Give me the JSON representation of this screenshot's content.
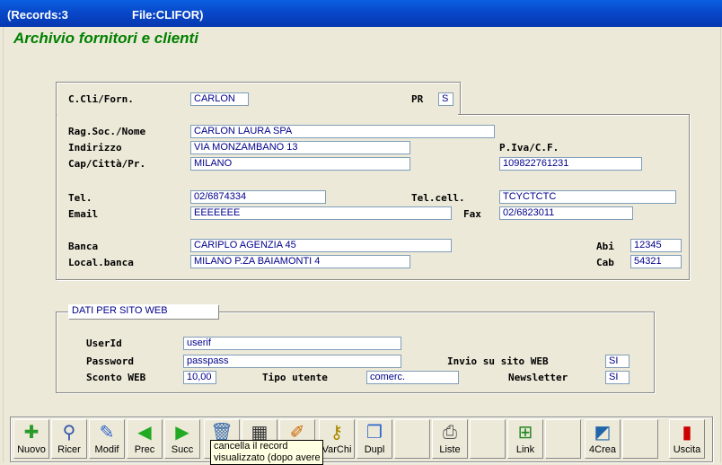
{
  "window": {
    "records": "(Records:3",
    "file": "File:CLIFOR)"
  },
  "app_title": "Archivio fornitori e clienti",
  "top": {
    "code_label": "C.Cli/Forn.",
    "code_value": "CARLON",
    "pr_label": "PR",
    "pr_value": "S"
  },
  "main": {
    "ragsoc_label": "Rag.Soc./Nome",
    "ragsoc_value": "CARLON LAURA SPA",
    "indirizzo_label": "Indirizzo",
    "indirizzo_value": "VIA MONZAMBANO 13",
    "piva_label": "P.Iva/C.F.",
    "piva_value": "109822761231",
    "cap_label": "Cap/Città/Pr.",
    "cap_value": "MILANO",
    "tel_label": "Tel.",
    "tel_value": "02/6874334",
    "telcell_label": "Tel.cell.",
    "telcell_value": "TCYCTCTC",
    "email_label": "Email",
    "email_value": "EEEEEEE",
    "fax_label": "Fax",
    "fax_value": "02/6823011",
    "banca_label": "Banca",
    "banca_value": "CARIPLO AGENZIA 45",
    "abi_label": "Abi",
    "abi_value": "12345",
    "localbanca_label": "Local.banca",
    "localbanca_value": "MILANO P.ZA BAIAMONTI 4",
    "cab_label": "Cab",
    "cab_value": "54321"
  },
  "web": {
    "section_title": "DATI PER SITO WEB",
    "userid_label": "UserId",
    "userid_value": "userif",
    "password_label": "Password",
    "password_value": "passpass",
    "invio_label": "Invio su sito WEB",
    "invio_value": "SI",
    "sconto_label": "Sconto WEB",
    "sconto_value": "10,00",
    "tipo_label": "Tipo utente",
    "tipo_value": "comerc.",
    "newsletter_label": "Newsletter",
    "newsletter_value": "SI"
  },
  "toolbar": {
    "nuovo": "Nuovo",
    "ricer": "Ricer",
    "modif": "Modif",
    "prec": "Prec",
    "succ": "Succ",
    "varchi": "VarChi",
    "dupl": "Dupl",
    "liste": "Liste",
    "link": "Link",
    "crea": "4Crea",
    "uscita": "Uscita"
  },
  "tooltip": {
    "line1": "cancella il record",
    "line2": "visualizzato (dopo avere"
  }
}
